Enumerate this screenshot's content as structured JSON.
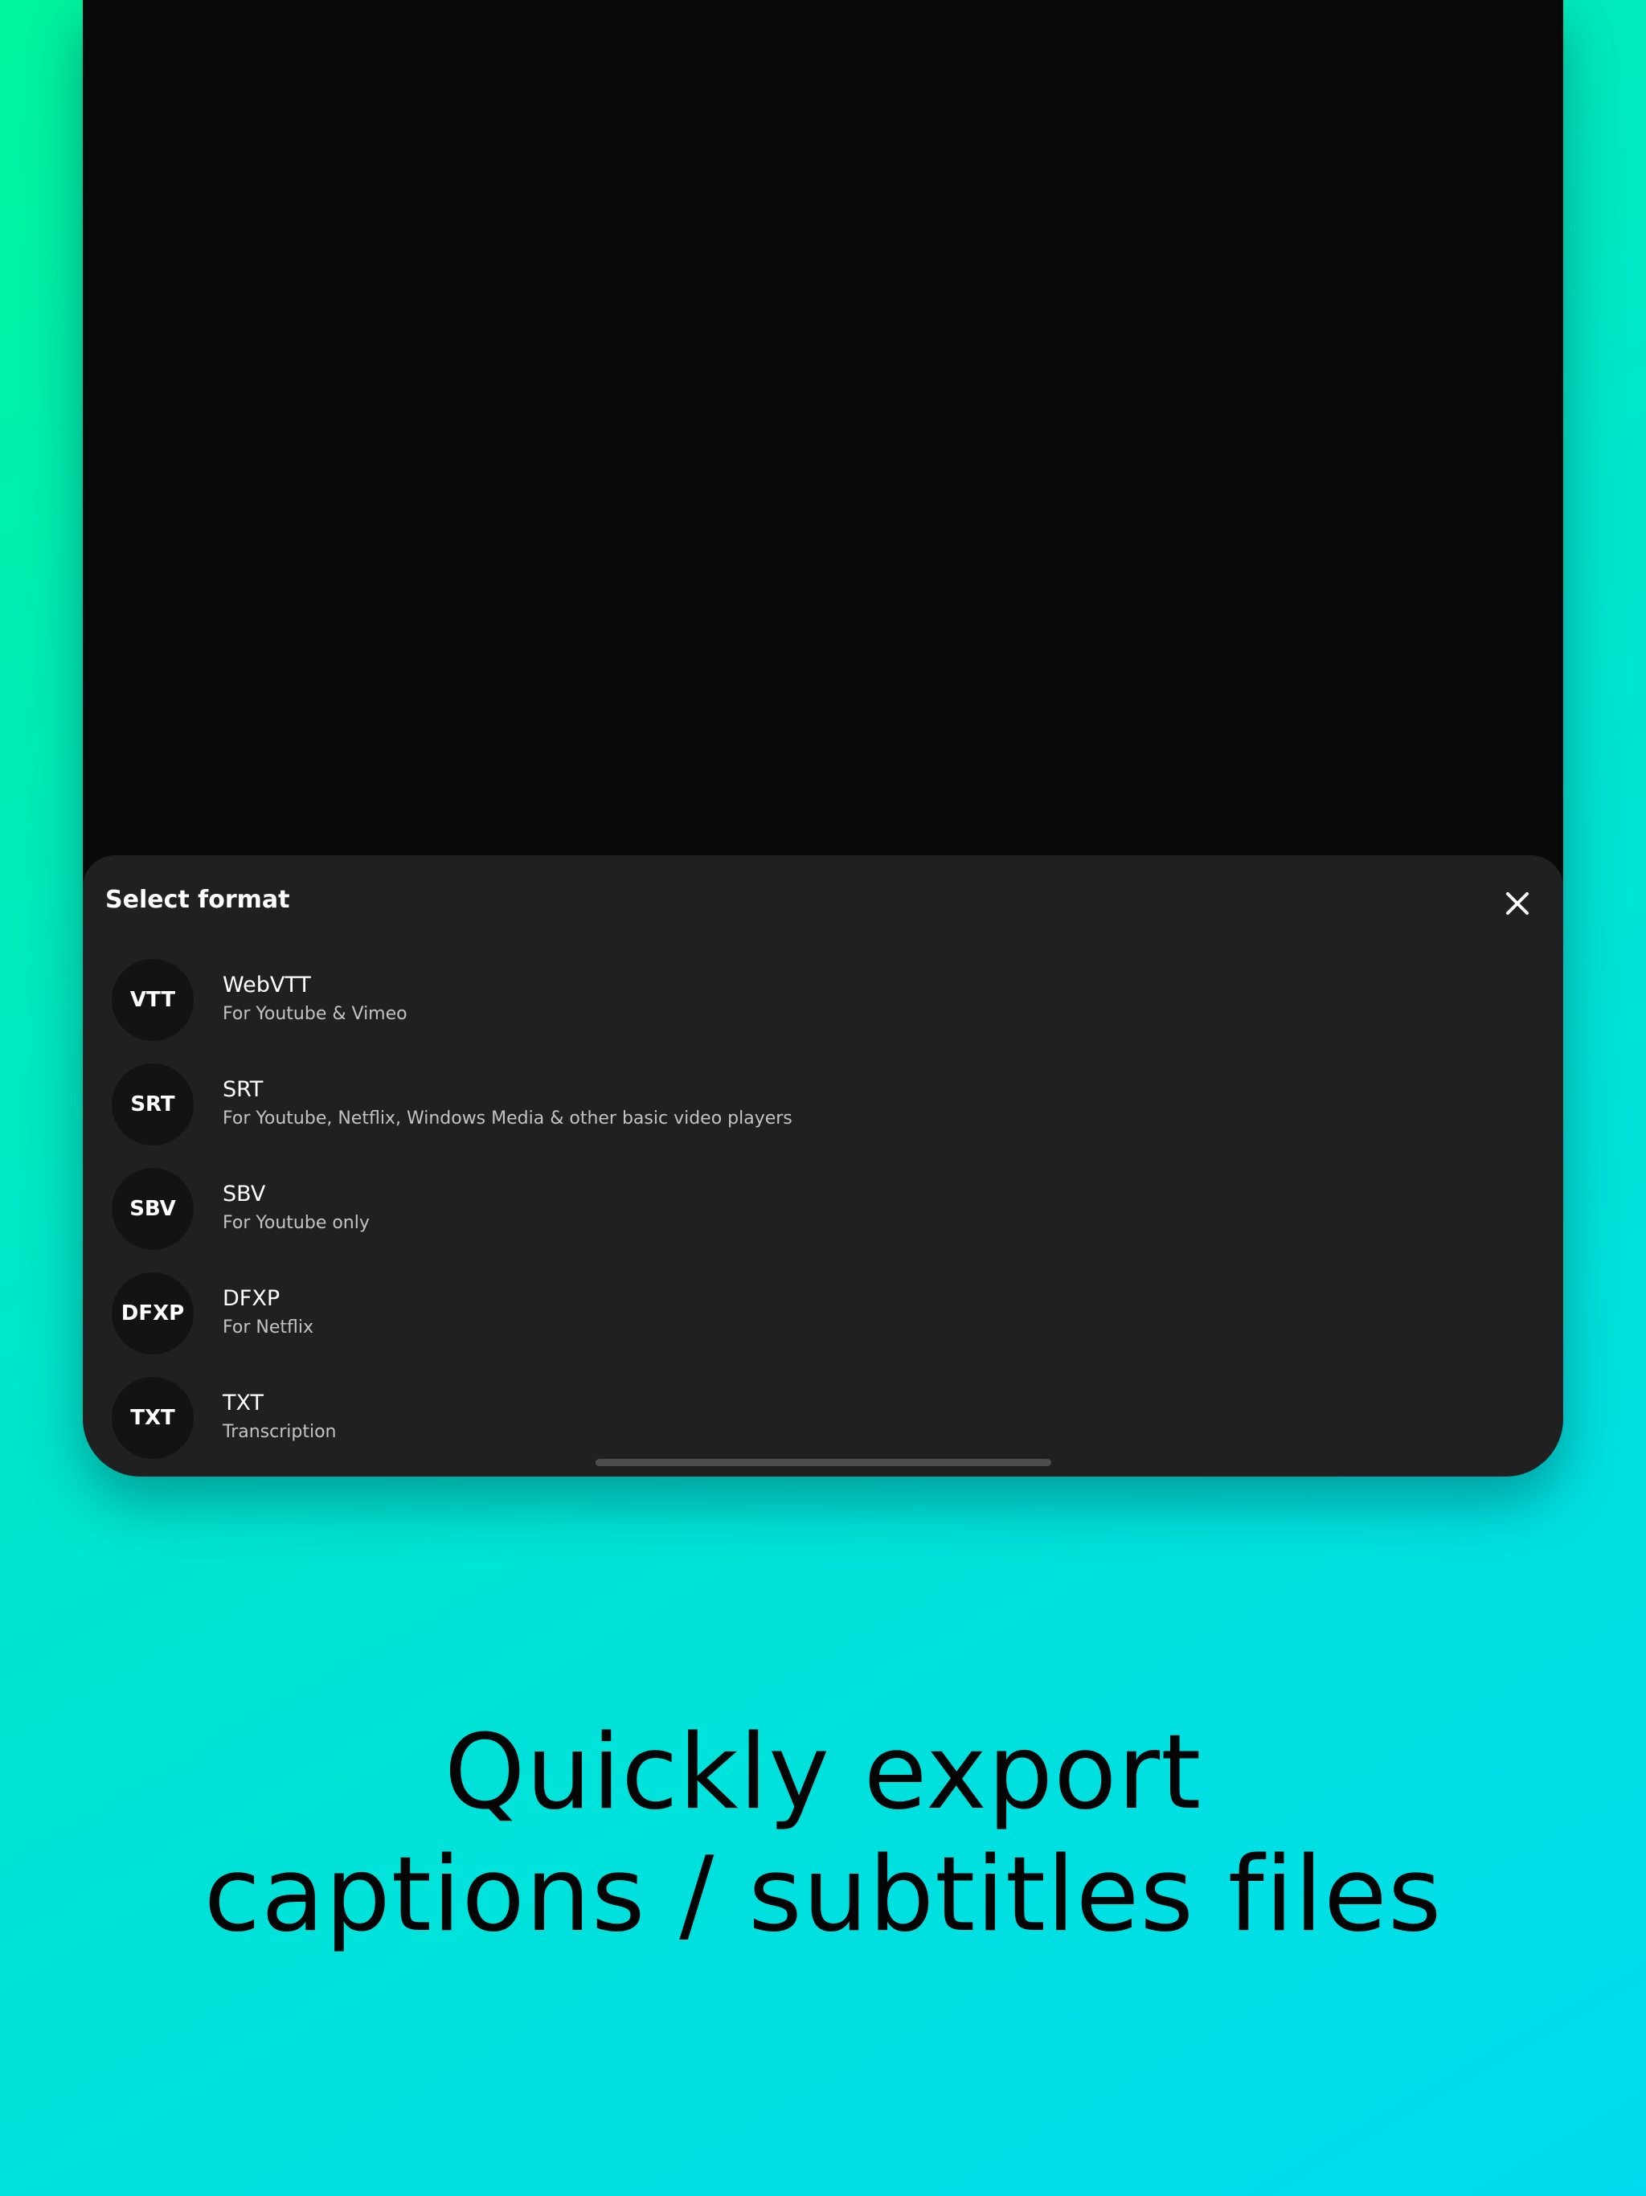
{
  "sheet": {
    "title": "Select format",
    "close_icon": "close-icon",
    "formats": [
      {
        "badge": "VTT",
        "name": "WebVTT",
        "description": "For Youtube & Vimeo"
      },
      {
        "badge": "SRT",
        "name": "SRT",
        "description": "For Youtube, Netflix, Windows Media & other basic video players"
      },
      {
        "badge": "SBV",
        "name": "SBV",
        "description": "For Youtube only"
      },
      {
        "badge": "DFXP",
        "name": "DFXP",
        "description": "For Netflix"
      },
      {
        "badge": "TXT",
        "name": "TXT",
        "description": "Transcription"
      }
    ]
  },
  "headline": {
    "line1": "Quickly export",
    "line2": "captions / subtitles files"
  },
  "colors": {
    "background_start": "#00f59c",
    "background_end": "#00dcef",
    "device": "#090909",
    "sheet": "#202020",
    "badge": "#131313"
  }
}
